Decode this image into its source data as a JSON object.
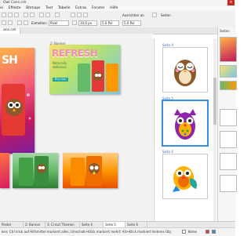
{
  "window": {
    "title": "Owl Cans.cdr"
  },
  "menu": {
    "items": [
      "ei",
      "Effekte",
      "Bitmaps",
      "Text",
      "Tabelle",
      "Extras",
      "Fenster",
      "Hilfe"
    ]
  },
  "toolbar": {
    "snap_label": "Ausrichten an",
    "pages_label": "Seiten",
    "units_label": "Einheiten:",
    "units_value": "Pixel",
    "nudge_value": "10,0 px",
    "dup_x": "5,0 Pxl",
    "dup_y": "5,0 Pxl"
  },
  "document": {
    "tab": "ans.cdr"
  },
  "canvas": {
    "banner_label": "2: Banner",
    "headline": "REFRESH",
    "tagline": "Naturally delicious.",
    "cta": "Buy now"
  },
  "page_panel": {
    "labels": [
      "Seite 4",
      "Seite 5",
      "Seite 6"
    ]
  },
  "right_panel": {
    "tab_label": "Seiten"
  },
  "bottom_tabs": [
    "Poster",
    "2: Banner",
    "3: Cricut Themen",
    "Seite 4",
    "Seite 5",
    "Seite 6"
  ],
  "status": {
    "message": "ken; Ctrl klick auf Hilfsmittel markiert alles; Umschalt+Klick markiert mehrf; Alt+Klick markiert hinteres Obj",
    "fill_label": "Keine"
  },
  "colors": {
    "accent": "#3b8ed8",
    "owl_brown": "#8b5a2b",
    "canvas_bg": "#f2f2f2"
  }
}
